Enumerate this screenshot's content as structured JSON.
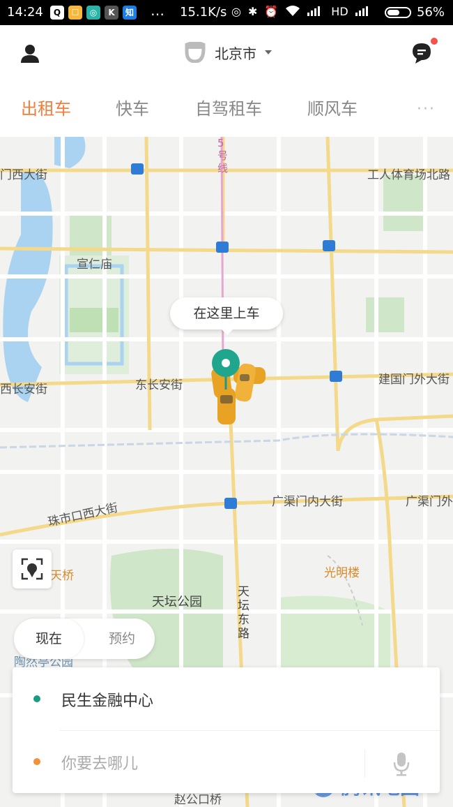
{
  "status_bar": {
    "time": "14:24",
    "apps": [
      "Q",
      "☐",
      "◎",
      "K",
      "知"
    ],
    "more": "…",
    "speed": "15.1K/s",
    "network": "HD",
    "battery": "56%",
    "battery_level": 0.56
  },
  "header": {
    "city": "北京市",
    "tabs": [
      {
        "label": "出租车",
        "active": true
      },
      {
        "label": "快车",
        "active": false
      },
      {
        "label": "自驾租车",
        "active": false
      },
      {
        "label": "顺风车",
        "active": false
      }
    ],
    "more": "···",
    "accent_color": "#f37d3b"
  },
  "map": {
    "labels": {
      "subway_line": "5号线",
      "fuchengmen": "门西大街",
      "workers_stadium": "工人体育场北路",
      "xuanren_temple": "宣仁庙",
      "west_chang_an": "西长安街",
      "east_chang_an": "东长安街",
      "jianguomen": "建国门外大街",
      "guangqumen_inner": "广渠门内大街",
      "guangqumen_outer": "广渠门外",
      "zhushikou": "珠市口西大街",
      "tianqiao": "天桥",
      "guangming": "光明楼",
      "temple_of_heaven": "天坛公园",
      "tiantan_east": "天坛东路",
      "taoranting": "陶然亭公园",
      "zhaogongkou": "赵公口桥"
    },
    "pickup_label": "在这里上车",
    "watermark": "腾讯地图"
  },
  "time_toggle": {
    "now": "现在",
    "reserve": "预约"
  },
  "trip": {
    "origin": "民生金融中心",
    "destination_placeholder": "你要去哪儿"
  }
}
